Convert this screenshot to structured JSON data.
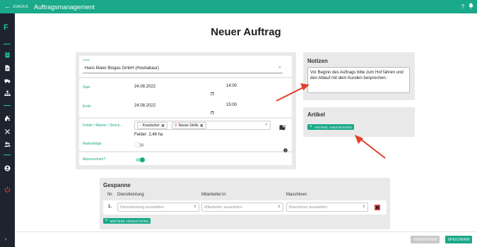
{
  "topbar": {
    "back_label": "ZURÜCK",
    "app_title": "Auftragsmanagement",
    "help_icon": "?",
    "bell_icon": "bell-icon",
    "color": "#1aa98a"
  },
  "sidebar": {
    "logo": "F",
    "icons": [
      "clipboard-icon",
      "document-icon",
      "truck-icon",
      "hierarchy-icon",
      "tractor-icon",
      "tools-icon",
      "users-icon",
      "account-icon",
      "power-icon"
    ],
    "expand_icon": "›"
  },
  "page": {
    "title": "Neuer Auftrag"
  },
  "form": {
    "kunde_label": "Kunde",
    "kunde_value": "Hans Maier Biogas GmbH (Houbabaur)",
    "start_label": "Start",
    "start_date": "24.08.2022",
    "start_time": "14:00",
    "ende_label": "Ende",
    "end_date": "24.08.2022",
    "end_time": "15:00",
    "felder_label": "Felder / Marker / Streck...",
    "tags": [
      "Krautacker",
      "Nasse Stelle"
    ],
    "felder_summary": "Felder: 2,46 ha",
    "reihenfolge_label": "Reihenfolge",
    "reihenfolge_on": false,
    "abzurechnen_label": "Abzurechnen?",
    "abzurechnen_on": true
  },
  "notizen": {
    "title": "Notizen",
    "text": "Vor Beginn des Auftrags bitte zum Hof fahren und den Ablauf mit dem Kunden besprechen."
  },
  "artikel": {
    "title": "Artikel",
    "add_label": "ARTIKEL HINZUFÜGEN"
  },
  "gespanne": {
    "title": "Gespanne",
    "col_nr": "Nr.",
    "col_dienstleistung": "Dienstleistung",
    "col_mitarbeiter": "Mitarbeiter:in",
    "col_maschinen": "Maschinen",
    "rows": [
      {
        "nr": "1.",
        "dienstleistung_placeholder": "Dienstleistung auswählen",
        "mitarbeiter_placeholder": "Mitarbeiter auswählen",
        "maschinen_placeholder": "Maschinen auswählen"
      }
    ],
    "add_label": "WEITERE HINZUFÜGEN"
  },
  "footer": {
    "cancel_label": "VERWERFEN",
    "save_label": "SPEICHERN"
  },
  "colors": {
    "accent": "#1aa98a",
    "annotation_arrow": "#e0402a",
    "danger": "#e23a3a"
  }
}
